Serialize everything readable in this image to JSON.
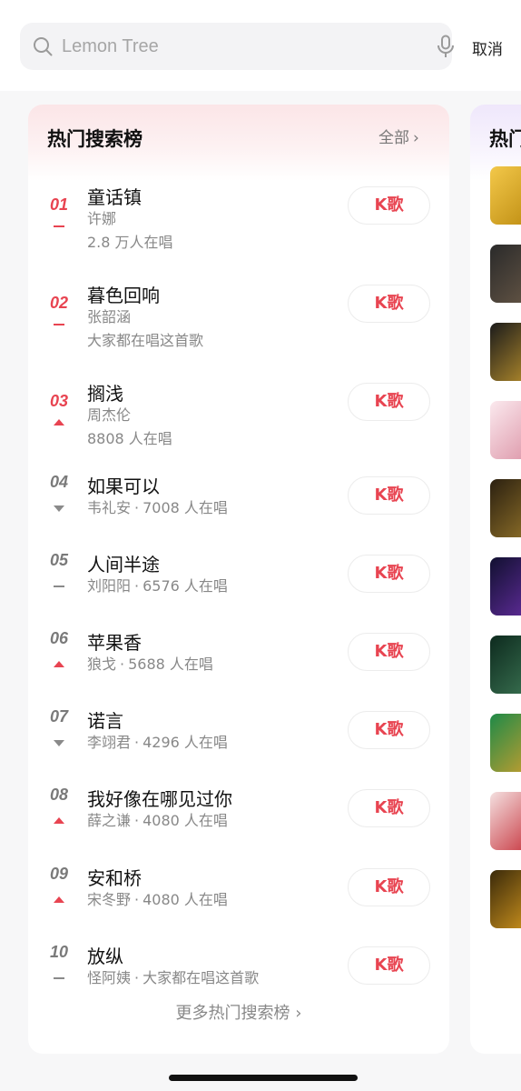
{
  "search": {
    "placeholder": "Lemon Tree"
  },
  "header": {
    "cancel_label": "取消"
  },
  "hot_chart": {
    "title": "热门搜索榜",
    "all_label": "全部",
    "more_label": "更多热门搜索榜",
    "k_label": "K歌",
    "items": [
      {
        "rank": "01",
        "trend": "same",
        "title": "童话镇",
        "artist": "许娜",
        "stat": "2.8 万人在唱"
      },
      {
        "rank": "02",
        "trend": "same",
        "title": "暮色回响",
        "artist": "张韶涵",
        "stat": "大家都在唱这首歌"
      },
      {
        "rank": "03",
        "trend": "up",
        "title": "搁浅",
        "artist": "周杰伦",
        "stat": "8808 人在唱"
      },
      {
        "rank": "04",
        "trend": "down",
        "title": "如果可以",
        "artist": "韦礼安",
        "stat": "7008 人在唱"
      },
      {
        "rank": "05",
        "trend": "same",
        "title": "人间半途",
        "artist": "刘阳阳",
        "stat": "6576 人在唱"
      },
      {
        "rank": "06",
        "trend": "up",
        "title": "苹果香",
        "artist": "狼戈",
        "stat": "5688 人在唱"
      },
      {
        "rank": "07",
        "trend": "down",
        "title": "诺言",
        "artist": "李翊君",
        "stat": "4296 人在唱"
      },
      {
        "rank": "08",
        "trend": "up",
        "title": "我好像在哪见过你",
        "artist": "薛之谦",
        "stat": "4080 人在唱"
      },
      {
        "rank": "09",
        "trend": "up",
        "title": "安和桥",
        "artist": "宋冬野",
        "stat": "4080 人在唱"
      },
      {
        "rank": "10",
        "trend": "same",
        "title": "放纵",
        "artist": "怪阿姨",
        "stat": "大家都在唱这首歌"
      }
    ]
  },
  "side_chart": {
    "title": "热门"
  },
  "colors": {
    "accent": "#e84451",
    "muted": "#888888"
  },
  "icons": {
    "search": "search-icon",
    "mic": "microphone-icon",
    "chevron": "chevron-right-icon"
  }
}
